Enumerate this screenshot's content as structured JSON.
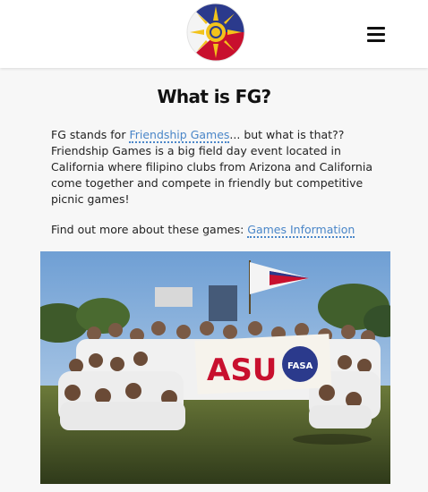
{
  "header": {
    "logo": {
      "description": "filipino-sun-logo"
    },
    "menu_icon": "hamburger-menu-icon"
  },
  "main": {
    "title": "What is FG?",
    "intro": {
      "before_link": "FG stands for ",
      "link_text": "Friendship Games",
      "after_link": "... but what is that?? Friendship Games is a big field day event located in California where filipino clubs from Arizona and California come together and compete in friendly but competitive picnic games!"
    },
    "more_info": {
      "before_link": "Find out more about these games: ",
      "link_text": "Games Information"
    },
    "photo": {
      "banner_text": "ASU",
      "emblem_text": "FASA"
    }
  },
  "colors": {
    "link": "#4a86c8",
    "flag_blue": "#2b3a8c",
    "flag_red": "#c8102e",
    "flag_yellow": "#f2c31b"
  }
}
